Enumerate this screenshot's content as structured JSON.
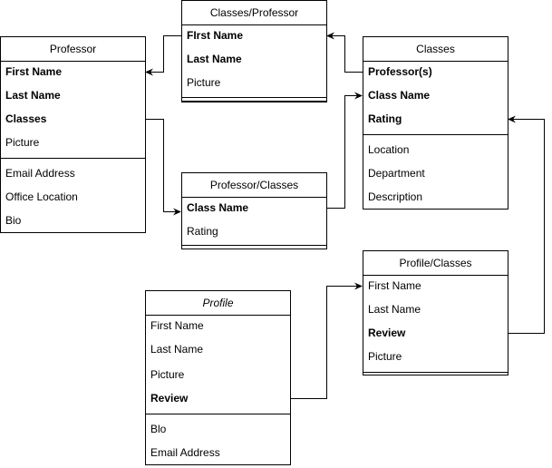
{
  "tables": [
    {
      "id": "professor",
      "title": "Professor",
      "italic": false,
      "rows": [
        {
          "text": "First Name",
          "bold": true
        },
        {
          "text": "Last Name",
          "bold": true
        },
        {
          "text": "Classes",
          "bold": true
        },
        {
          "text": "Picture",
          "bold": false
        }
      ],
      "extra": [
        {
          "text": "Email Address",
          "bold": false
        },
        {
          "text": "Office Location",
          "bold": false
        },
        {
          "text": "Bio",
          "bold": false
        }
      ]
    },
    {
      "id": "classes-professor",
      "title": "Classes/Professor",
      "italic": false,
      "rows": [
        {
          "text": "FIrst Name",
          "bold": true
        },
        {
          "text": "Last Name",
          "bold": true
        },
        {
          "text": "Picture",
          "bold": false
        }
      ],
      "extra": []
    },
    {
      "id": "classes",
      "title": "Classes",
      "italic": false,
      "rows": [
        {
          "text": "Professor(s)",
          "bold": true
        },
        {
          "text": "Class Name",
          "bold": true
        },
        {
          "text": "Rating",
          "bold": true
        }
      ],
      "extra": [
        {
          "text": "Location",
          "bold": false
        },
        {
          "text": "Department",
          "bold": false
        },
        {
          "text": "Description",
          "bold": false
        }
      ]
    },
    {
      "id": "professor-classes",
      "title": "Professor/Classes",
      "italic": false,
      "rows": [
        {
          "text": "Class Name",
          "bold": true
        },
        {
          "text": "Rating",
          "bold": false
        }
      ],
      "extra": []
    },
    {
      "id": "profile-classes",
      "title": "Profile/Classes",
      "italic": false,
      "rows": [
        {
          "text": "First Name",
          "bold": false
        },
        {
          "text": "Last Name",
          "bold": false
        },
        {
          "text": "Review",
          "bold": true
        },
        {
          "text": "Picture",
          "bold": false
        }
      ],
      "extra": []
    },
    {
      "id": "profile",
      "title": "Profile",
      "italic": true,
      "rows": [
        {
          "text": "First Name",
          "bold": false
        },
        {
          "text": "Last Name",
          "bold": false
        },
        {
          "text": "Picture",
          "bold": false
        },
        {
          "text": "Review",
          "bold": true
        }
      ],
      "extra": [
        {
          "text": "Blo",
          "bold": false
        },
        {
          "text": "Email Address",
          "bold": false
        }
      ]
    }
  ],
  "connections": [
    {
      "from": "classes-professor.FIrst Name",
      "to": "professor.First Name"
    },
    {
      "from": "professor.Classes",
      "to": "professor-classes.Class Name"
    },
    {
      "from": "professor-classes.Class Name",
      "to": "classes.Class Name"
    },
    {
      "from": "classes.Professor(s)",
      "to": "classes-professor.FIrst Name"
    },
    {
      "from": "profile.Review",
      "to": "profile-classes.First Name"
    },
    {
      "from": "profile-classes.Review",
      "to": "classes.Rating"
    }
  ]
}
